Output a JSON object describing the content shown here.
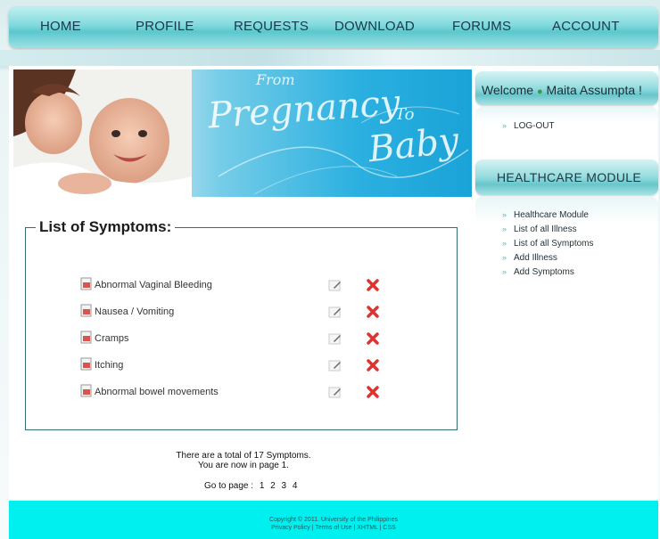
{
  "nav": {
    "items": [
      "HOME",
      "PROFILE",
      "REQUESTS",
      "DOWNLOAD",
      "FORUMS",
      "ACCOUNT"
    ]
  },
  "banner": {
    "from": "From",
    "pregnancy": "Pregnancy",
    "to": "To",
    "baby": "Baby"
  },
  "sidebar": {
    "welcome_prefix": "Welcome",
    "user_name": "Maita Assumpta !",
    "logout": "LOG-OUT",
    "module_title": "HEALTHCARE MODULE",
    "links": [
      "Healthcare Module",
      "List of all Illness",
      "List of all Symptoms",
      "Add Illness",
      "Add Symptoms"
    ]
  },
  "main": {
    "legend": "List of Symptoms:",
    "symptoms": [
      "Abnormal Vaginal Bleeding",
      "Nausea / Vomiting",
      "Cramps",
      "Itching",
      "Abnormal bowel movements"
    ],
    "total_text": "There are a total of 17 Symptoms.",
    "page_text": "You are now in page 1.",
    "goto_label": "Go to page :",
    "pages": [
      "1",
      "2",
      "3",
      "4"
    ]
  },
  "footer": {
    "copyright": "Copyright © 2011. University of the Philippines",
    "links": "Privacy Policy | Terms of Use | XHTML | CSS"
  },
  "colors": {
    "nav": "#7fd9dc",
    "footer": "#00f0f0",
    "delete": "#e0332f"
  }
}
